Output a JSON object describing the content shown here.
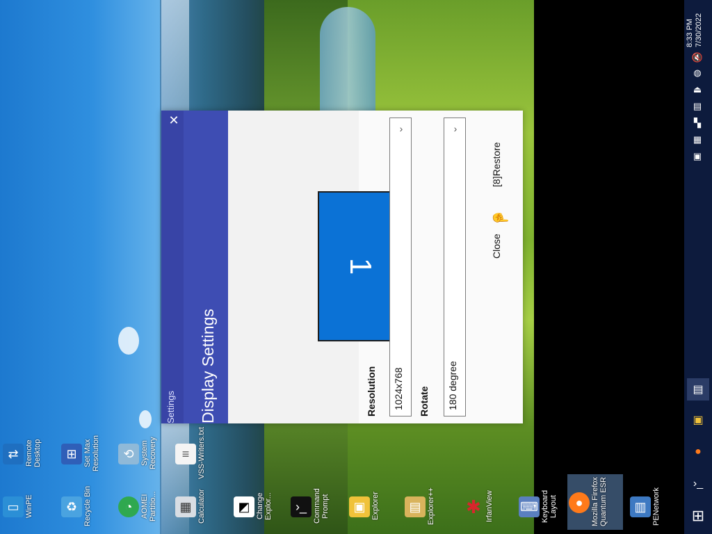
{
  "desktop_icons": [
    {
      "label": "WinPE",
      "icon": "monitor-icon"
    },
    {
      "label": "Remote Desktop",
      "icon": "remote-desktop-icon"
    },
    {
      "label": "Recycle Bin",
      "icon": "recycle-bin-icon"
    },
    {
      "label": "Set Max Resolution",
      "icon": "set-resolution-icon"
    },
    {
      "label": "AOMEI Partitio...",
      "icon": "partition-icon"
    },
    {
      "label": "System Recovery",
      "icon": "system-recovery-icon"
    },
    {
      "label": "Calculator",
      "icon": "calculator-icon"
    },
    {
      "label": "VSS-Writers.txt",
      "icon": "text-file-icon"
    },
    {
      "label": "Change Explor...",
      "icon": "change-explorer-icon"
    },
    {
      "label": "Command Prompt",
      "icon": "command-prompt-icon"
    },
    {
      "label": "Explorer",
      "icon": "explorer-icon"
    },
    {
      "label": "Explorer++",
      "icon": "explorer-plus-icon"
    },
    {
      "label": "IrfanView",
      "icon": "irfanview-icon"
    },
    {
      "label": "Keyboard Layout",
      "icon": "keyboard-icon"
    },
    {
      "label": "Mozilla Firefox Quantum ESR",
      "icon": "firefox-icon"
    },
    {
      "label": "PENetwork",
      "icon": "network-icon"
    }
  ],
  "window": {
    "app_label": "Settings",
    "title": "Display Settings",
    "close_glyph": "✕",
    "monitor_number": "1",
    "resolution_label": "Resolution",
    "resolution_value": "1024x768",
    "rotate_label": "Rotate",
    "rotate_value": "180 degree",
    "close_button": "Close",
    "restore_button": "[8]Restore",
    "chevron": "›"
  },
  "taskbar": {
    "time": "8:33 PM",
    "date": "7/30/2022",
    "start_glyph": "⊞"
  },
  "colors": {
    "window_header": "#3e4db3",
    "monitor_fill": "#0b72d6",
    "taskbar": "#0d1b3d"
  }
}
